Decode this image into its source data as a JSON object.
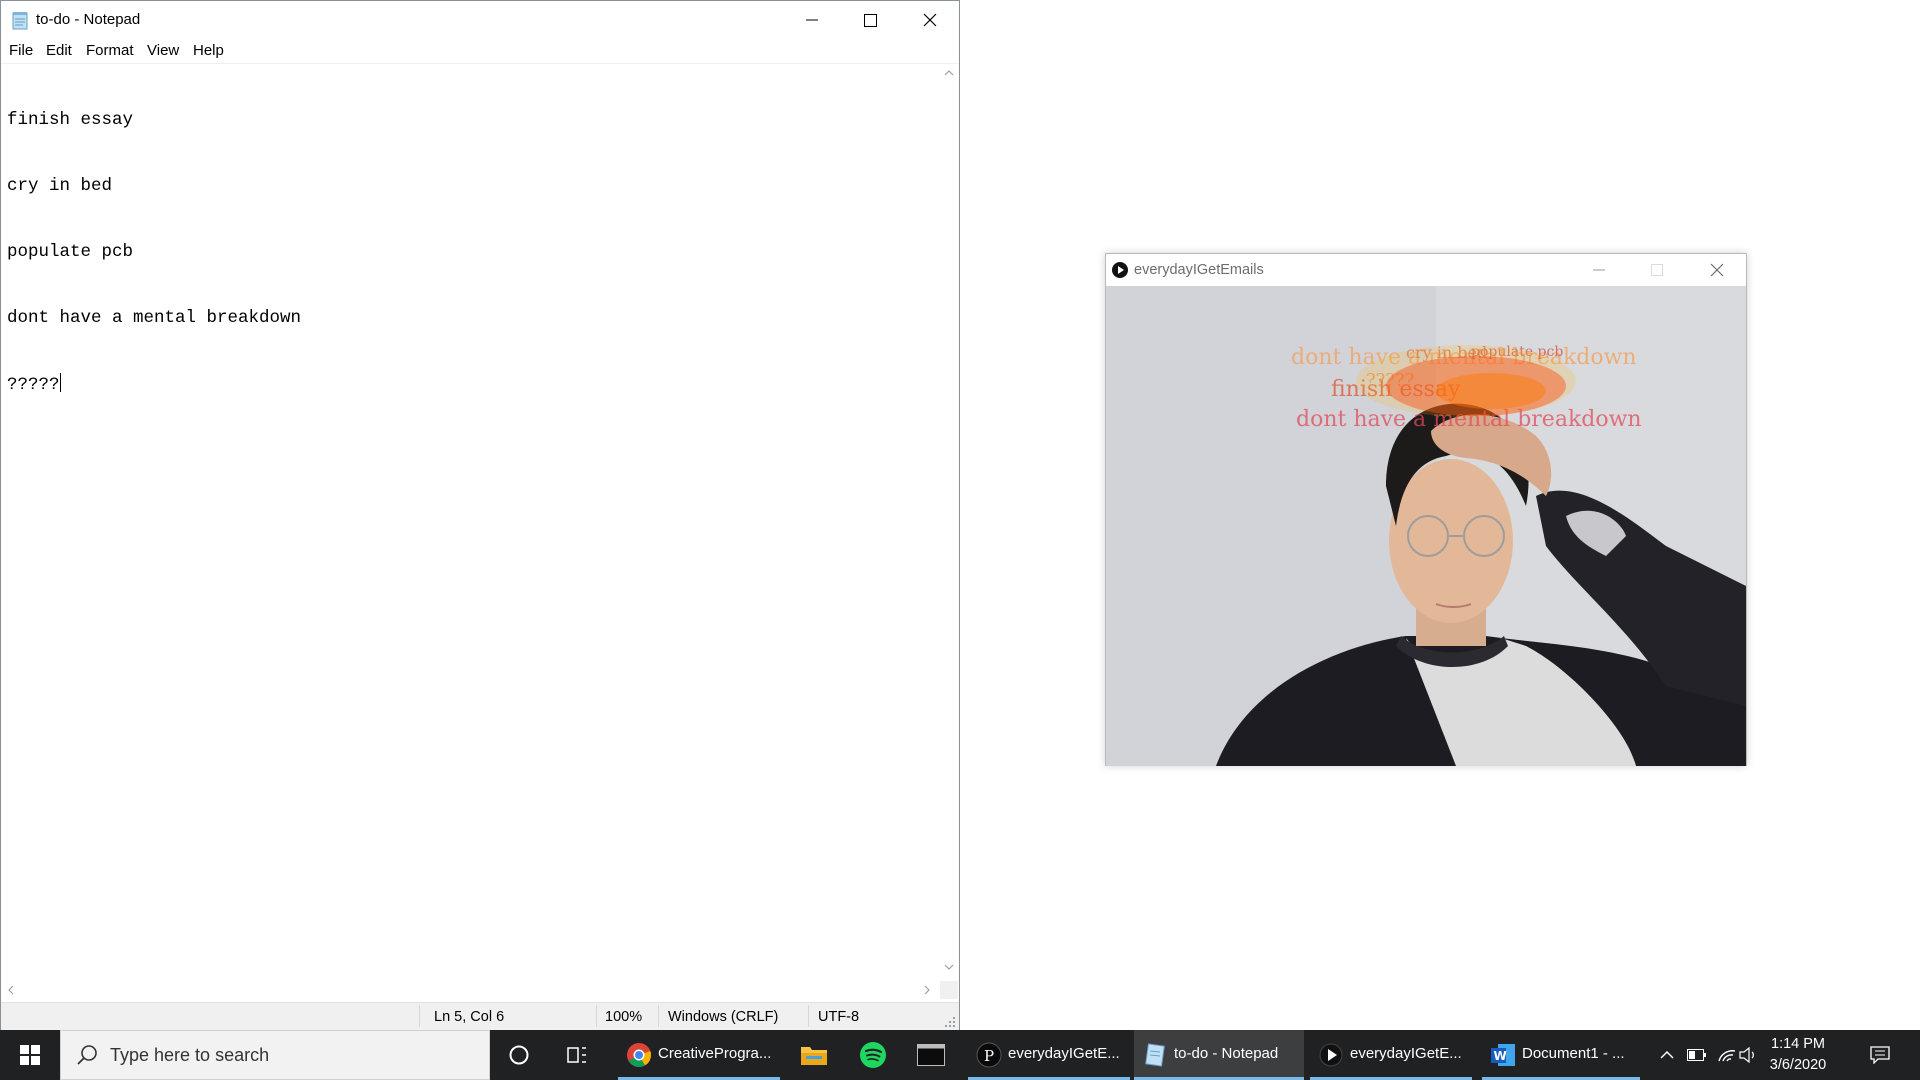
{
  "notepad": {
    "title": "to-do - Notepad",
    "menu": [
      "File",
      "Edit",
      "Format",
      "View",
      "Help"
    ],
    "lines": [
      "finish essay",
      "cry in bed",
      "populate pcb",
      "dont have a mental breakdown",
      "?????"
    ],
    "status": {
      "position": "Ln 5, Col 6",
      "zoom": "100%",
      "line_ending": "Windows (CRLF)",
      "encoding": "UTF-8"
    }
  },
  "processing_window": {
    "title": "everydayIGetEmails",
    "overlay_words": [
      "dont have a mental breakdown",
      "cry in bed",
      "populate pcb",
      "finish essay",
      "?????"
    ]
  },
  "taskbar": {
    "search_placeholder": "Type here to search",
    "tasks": [
      {
        "label": "CreativeProgra...",
        "icon": "chrome-icon",
        "active": false
      },
      {
        "label": "everydayIGetE...",
        "icon": "processing-icon",
        "active": false
      },
      {
        "label": "to-do - Notepad",
        "icon": "notepad-icon",
        "active": true
      },
      {
        "label": "everydayIGetE...",
        "icon": "sketch-run-icon",
        "active": false
      },
      {
        "label": "Document1 - ...",
        "icon": "word-icon",
        "active": false
      }
    ],
    "pinned": [
      "cortana-icon",
      "task-view-icon",
      "file-explorer-icon",
      "spotify-icon",
      "terminal-icon"
    ],
    "clock": {
      "time": "1:14 PM",
      "date": "3/6/2020"
    },
    "accent_color": "#76b9ed",
    "background_color": "#202123"
  }
}
